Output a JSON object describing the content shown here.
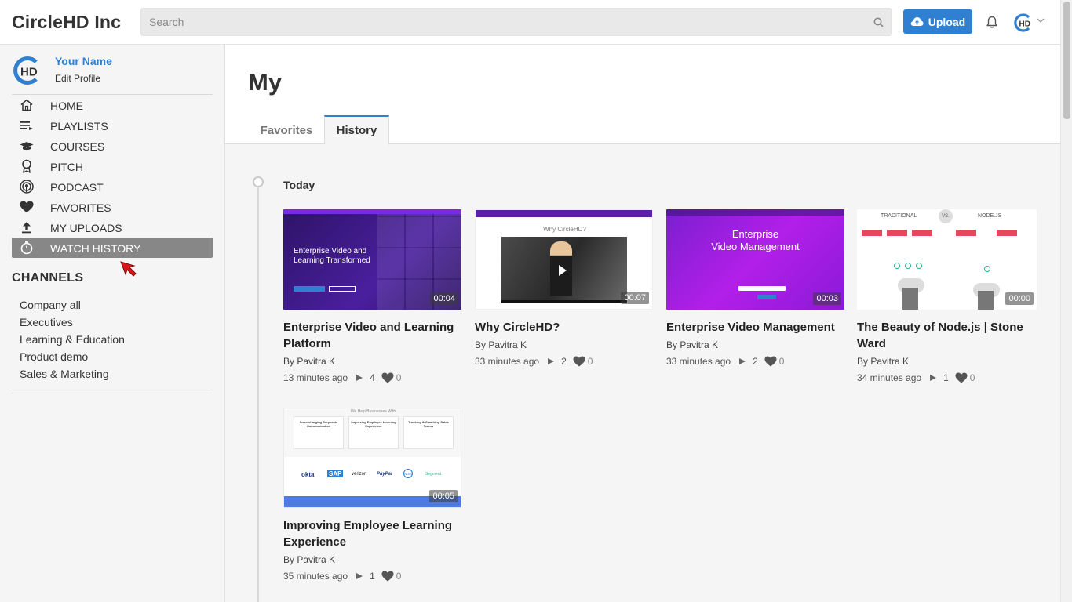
{
  "brand": "CircleHD Inc",
  "search": {
    "placeholder": "Search"
  },
  "header": {
    "upload_label": "Upload",
    "avatar_text": "HD"
  },
  "profile": {
    "name": "Your Name",
    "edit_label": "Edit Profile",
    "avatar_text": "HD"
  },
  "nav": {
    "items": [
      {
        "label": "HOME",
        "icon": "home-icon"
      },
      {
        "label": "PLAYLISTS",
        "icon": "playlist-icon"
      },
      {
        "label": "COURSES",
        "icon": "graduation-cap-icon"
      },
      {
        "label": "PITCH",
        "icon": "award-icon"
      },
      {
        "label": "PODCAST",
        "icon": "podcast-icon"
      },
      {
        "label": "FAVORITES",
        "icon": "heart-icon"
      },
      {
        "label": "MY UPLOADS",
        "icon": "upload-icon"
      },
      {
        "label": "WATCH HISTORY",
        "icon": "stopwatch-icon",
        "active": true
      }
    ]
  },
  "channels": {
    "title": "CHANNELS",
    "items": [
      "Company all",
      "Executives",
      "Learning & Education",
      "Product demo",
      "Sales & Marketing"
    ]
  },
  "main": {
    "title": "My",
    "tabs": [
      {
        "label": "Favorites",
        "active": false
      },
      {
        "label": "History",
        "active": true
      }
    ],
    "day_label": "Today"
  },
  "videos": [
    {
      "title": "Enterprise Video and Learning Platform",
      "author": "By Pavitra K",
      "ago": "13 minutes ago",
      "views": "4",
      "likes": "0",
      "duration": "00:04",
      "thumb_style": "purple-grid"
    },
    {
      "title": "Why CircleHD?",
      "author": "By Pavitra K",
      "ago": "33 minutes ago",
      "views": "2",
      "likes": "0",
      "duration": "00:07",
      "thumb_style": "white-video"
    },
    {
      "title": "Enterprise Video Management",
      "author": "By Pavitra K",
      "ago": "33 minutes ago",
      "views": "2",
      "likes": "0",
      "duration": "00:03",
      "thumb_style": "magenta"
    },
    {
      "title": "The Beauty of Node.js | Stone Ward",
      "author": "By Pavitra K",
      "ago": "34 minutes ago",
      "views": "1",
      "likes": "0",
      "duration": "00:00",
      "thumb_style": "diagram"
    },
    {
      "title": "Improving Employee Learning Experience",
      "author": "By Pavitra K",
      "ago": "35 minutes ago",
      "views": "1",
      "likes": "0",
      "duration": "00:05",
      "thumb_style": "logos"
    }
  ],
  "thumb_text": {
    "v0_heading_a": "Enterprise Video and",
    "v0_heading_b": "Learning Transformed",
    "v1_heading": "Why CircleHD?",
    "v2_heading_a": "Enterprise",
    "v2_heading_b": "Video Management",
    "v3_left": "TRADITIONAL",
    "v3_vs": "VS.",
    "v3_right": "NODE.JS",
    "v4_heading": "We Help Businesses With",
    "v4_col1": "Supercharging Corporate Communication",
    "v4_col2": "Improving Employee Learning Experience",
    "v4_col3": "Tracking & Coaching Sales Teams",
    "v4_logos": [
      "okta",
      "SAP",
      "verizon",
      "PayPal",
      "NOM",
      "Segment"
    ]
  },
  "colors": {
    "accent": "#2f80d1",
    "active_nav": "#878787",
    "thumb_purple": "#5b1fa8",
    "thumb_magenta": "#9c1fe0"
  }
}
